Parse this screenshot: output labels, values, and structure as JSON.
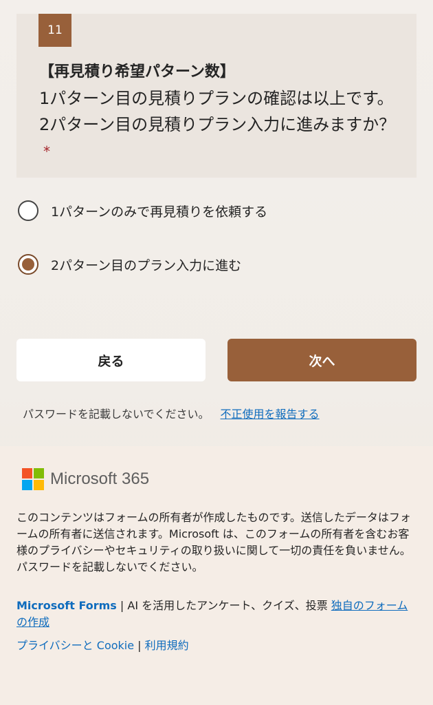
{
  "question": {
    "number": "11",
    "title": "【再見積り希望パターン数】",
    "body": "1パターン目の見積りプランの確認は以上です。2パターン目の見積りプラン入力に進みますか？",
    "required_mark": "*"
  },
  "options": [
    {
      "label": "1パターンのみで再見積りを依頼する",
      "selected": false
    },
    {
      "label": "2パターン目のプラン入力に進む",
      "selected": true
    }
  ],
  "buttons": {
    "back": "戻る",
    "next": "次へ"
  },
  "password_note": {
    "text": "パスワードを記載しないでください。",
    "report_link": "不正使用を報告する"
  },
  "footer": {
    "brand": "Microsoft 365",
    "disclaimer": "このコンテンツはフォームの所有者が作成したものです。送信したデータはフォームの所有者に送信されます。Microsoft は、このフォームの所有者を含むお客様のプライバシーやセキュリティの取り扱いに関して一切の責任を負いません。パスワードを記載しないでください。",
    "forms_brand": "Microsoft Forms",
    "forms_separator": " | ",
    "forms_tagline": "AI を活用したアンケート、クイズ、投票 ",
    "create_link": "独自のフォームの作成",
    "privacy_link": "プライバシーと Cookie",
    "privacy_separator": " | ",
    "terms_link": "利用規約"
  },
  "colors": {
    "accent": "#98603a",
    "link": "#0f6cbd",
    "required": "#a4262c"
  },
  "icons": {
    "logo": "microsoft-logo-icon",
    "radio_unselected": "radio-unselected-icon",
    "radio_selected": "radio-selected-icon"
  }
}
